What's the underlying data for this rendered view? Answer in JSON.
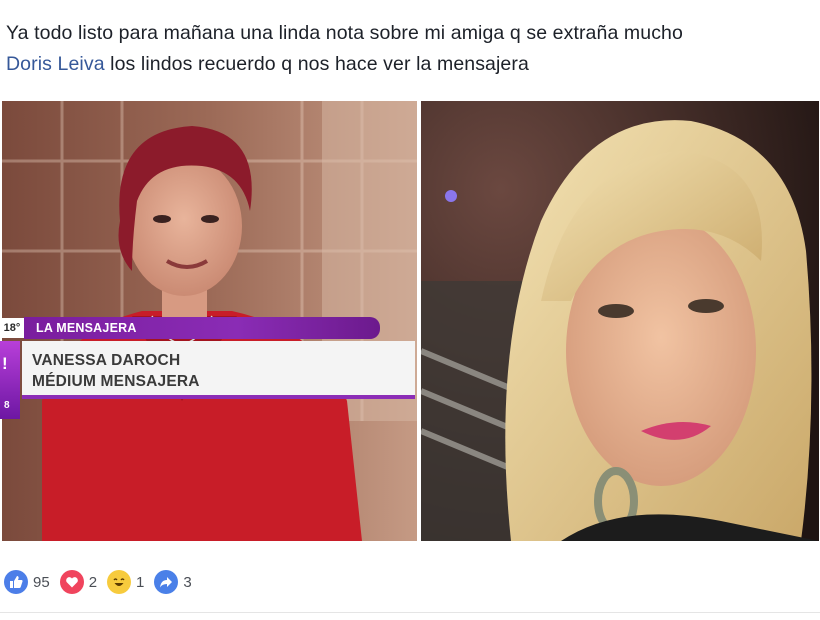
{
  "post": {
    "line1": "Ya todo listo para mañana una linda nota sobre mi amiga q se extraña mucho",
    "mention": "Doris Leiva",
    "line2_rest": " los lindos recuerdo q nos hace ver la mensajera"
  },
  "photos": {
    "left": {
      "tv_graphic": {
        "channel_number": "18°",
        "header": "LA MENSAJERA",
        "name": "VANESSA DAROCH",
        "role": "MÉDIUM MENSAJERA",
        "logo_mark": "!",
        "logo_sub": "8"
      }
    }
  },
  "reactions": [
    {
      "type": "like",
      "icon": "thumbs-up-icon",
      "count": "95"
    },
    {
      "type": "love",
      "icon": "heart-icon",
      "count": "2"
    },
    {
      "type": "haha",
      "icon": "laughing-face-icon",
      "count": "1"
    },
    {
      "type": "share",
      "icon": "share-arrow-icon",
      "count": "3"
    }
  ],
  "colors": {
    "link": "#365899",
    "tv_purple": "#8a2cb5",
    "like_blue": "#4c7ee8",
    "love_red": "#f0445d"
  }
}
